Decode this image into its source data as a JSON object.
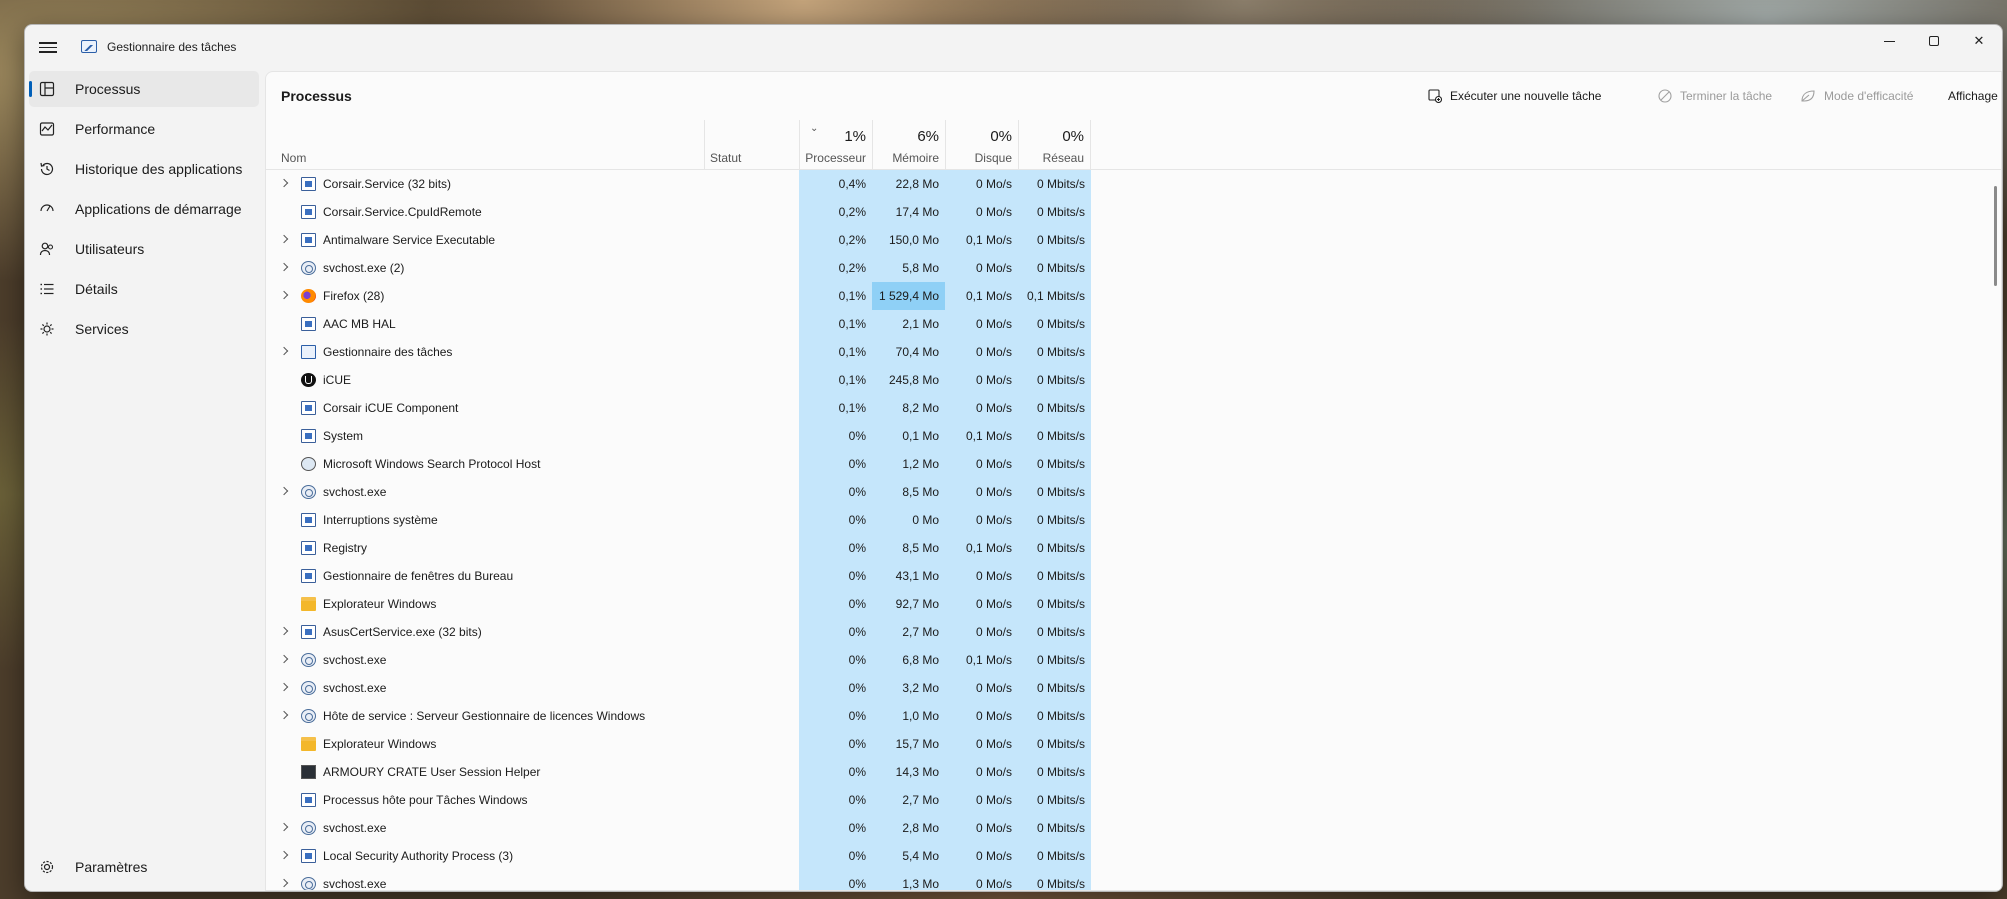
{
  "app": {
    "title": "Gestionnaire des tâches"
  },
  "sidebar": {
    "items": [
      {
        "label": "Processus",
        "icon": "processes-icon",
        "active": true
      },
      {
        "label": "Performance",
        "icon": "performance-icon"
      },
      {
        "label": "Historique des applications",
        "icon": "history-icon"
      },
      {
        "label": "Applications de démarrage",
        "icon": "startup-icon"
      },
      {
        "label": "Utilisateurs",
        "icon": "users-icon"
      },
      {
        "label": "Détails",
        "icon": "details-icon"
      },
      {
        "label": "Services",
        "icon": "services-icon"
      }
    ],
    "settings_label": "Paramètres"
  },
  "toolbar": {
    "page_title": "Processus",
    "run_task": "Exécuter une nouvelle tâche",
    "end_task": "Terminer la tâche",
    "efficiency": "Mode d'efficacité",
    "view": "Affichage"
  },
  "columns": {
    "name": "Nom",
    "status": "Statut",
    "cpu": {
      "pct": "1%",
      "label": "Processeur"
    },
    "mem": {
      "pct": "6%",
      "label": "Mémoire"
    },
    "disk": {
      "pct": "0%",
      "label": "Disque"
    },
    "net": {
      "pct": "0%",
      "label": "Réseau"
    }
  },
  "colors": {
    "accent": "#005fb8",
    "cell_bg": "#c5e6fb",
    "cell_highlight": "#8fd0f6"
  },
  "processes": [
    {
      "name": "Corsair.Service (32 bits)",
      "icon": "win",
      "expandable": true,
      "cpu": "0,4%",
      "mem": "22,8 Mo",
      "disk": "0 Mo/s",
      "net": "0 Mbits/s"
    },
    {
      "name": "Corsair.Service.CpuIdRemote",
      "icon": "win",
      "expandable": false,
      "cpu": "0,2%",
      "mem": "17,4 Mo",
      "disk": "0 Mo/s",
      "net": "0 Mbits/s"
    },
    {
      "name": "Antimalware Service Executable",
      "icon": "win",
      "expandable": true,
      "cpu": "0,2%",
      "mem": "150,0 Mo",
      "disk": "0,1 Mo/s",
      "net": "0 Mbits/s"
    },
    {
      "name": "svchost.exe (2)",
      "icon": "gear",
      "expandable": true,
      "cpu": "0,2%",
      "mem": "5,8 Mo",
      "disk": "0 Mo/s",
      "net": "0 Mbits/s"
    },
    {
      "name": "Firefox (28)",
      "icon": "ff",
      "expandable": true,
      "cpu": "0,1%",
      "mem": "1 529,4 Mo",
      "mem_hi": true,
      "disk": "0,1 Mo/s",
      "net": "0,1 Mbits/s"
    },
    {
      "name": "AAC MB HAL",
      "icon": "win",
      "expandable": false,
      "cpu": "0,1%",
      "mem": "2,1 Mo",
      "disk": "0 Mo/s",
      "net": "0 Mbits/s"
    },
    {
      "name": "Gestionnaire des tâches",
      "icon": "tm",
      "expandable": true,
      "cpu": "0,1%",
      "mem": "70,4 Mo",
      "disk": "0 Mo/s",
      "net": "0 Mbits/s"
    },
    {
      "name": "iCUE",
      "icon": "icue",
      "expandable": false,
      "cpu": "0,1%",
      "mem": "245,8 Mo",
      "disk": "0 Mo/s",
      "net": "0 Mbits/s"
    },
    {
      "name": "Corsair iCUE Component",
      "icon": "win",
      "expandable": false,
      "cpu": "0,1%",
      "mem": "8,2 Mo",
      "disk": "0 Mo/s",
      "net": "0 Mbits/s"
    },
    {
      "name": "System",
      "icon": "win",
      "expandable": false,
      "cpu": "0%",
      "mem": "0,1 Mo",
      "disk": "0,1 Mo/s",
      "net": "0 Mbits/s"
    },
    {
      "name": "Microsoft Windows Search Protocol Host",
      "icon": "search",
      "expandable": false,
      "cpu": "0%",
      "mem": "1,2 Mo",
      "disk": "0 Mo/s",
      "net": "0 Mbits/s"
    },
    {
      "name": "svchost.exe",
      "icon": "gear",
      "expandable": true,
      "cpu": "0%",
      "mem": "8,5 Mo",
      "disk": "0 Mo/s",
      "net": "0 Mbits/s"
    },
    {
      "name": "Interruptions système",
      "icon": "win",
      "expandable": false,
      "cpu": "0%",
      "mem": "0 Mo",
      "disk": "0 Mo/s",
      "net": "0 Mbits/s"
    },
    {
      "name": "Registry",
      "icon": "win",
      "expandable": false,
      "cpu": "0%",
      "mem": "8,5 Mo",
      "disk": "0,1 Mo/s",
      "net": "0 Mbits/s"
    },
    {
      "name": "Gestionnaire de fenêtres du Bureau",
      "icon": "win",
      "expandable": false,
      "cpu": "0%",
      "mem": "43,1 Mo",
      "disk": "0 Mo/s",
      "net": "0 Mbits/s"
    },
    {
      "name": "Explorateur Windows",
      "icon": "folder",
      "expandable": false,
      "cpu": "0%",
      "mem": "92,7 Mo",
      "disk": "0 Mo/s",
      "net": "0 Mbits/s"
    },
    {
      "name": "AsusCertService.exe (32 bits)",
      "icon": "win",
      "expandable": true,
      "cpu": "0%",
      "mem": "2,7 Mo",
      "disk": "0 Mo/s",
      "net": "0 Mbits/s"
    },
    {
      "name": "svchost.exe",
      "icon": "gear",
      "expandable": true,
      "cpu": "0%",
      "mem": "6,8 Mo",
      "disk": "0,1 Mo/s",
      "net": "0 Mbits/s"
    },
    {
      "name": "svchost.exe",
      "icon": "gear",
      "expandable": true,
      "cpu": "0%",
      "mem": "3,2 Mo",
      "disk": "0 Mo/s",
      "net": "0 Mbits/s"
    },
    {
      "name": "Hôte de service : Serveur Gestionnaire de licences Windows",
      "icon": "gear",
      "expandable": true,
      "cpu": "0%",
      "mem": "1,0 Mo",
      "disk": "0 Mo/s",
      "net": "0 Mbits/s"
    },
    {
      "name": "Explorateur Windows",
      "icon": "folder",
      "expandable": false,
      "cpu": "0%",
      "mem": "15,7 Mo",
      "disk": "0 Mo/s",
      "net": "0 Mbits/s"
    },
    {
      "name": "ARMOURY CRATE User Session Helper",
      "icon": "dark",
      "expandable": false,
      "cpu": "0%",
      "mem": "14,3 Mo",
      "disk": "0 Mo/s",
      "net": "0 Mbits/s"
    },
    {
      "name": "Processus hôte pour Tâches Windows",
      "icon": "win",
      "expandable": false,
      "cpu": "0%",
      "mem": "2,7 Mo",
      "disk": "0 Mo/s",
      "net": "0 Mbits/s"
    },
    {
      "name": "svchost.exe",
      "icon": "gear",
      "expandable": true,
      "cpu": "0%",
      "mem": "2,8 Mo",
      "disk": "0 Mo/s",
      "net": "0 Mbits/s"
    },
    {
      "name": "Local Security Authority Process (3)",
      "icon": "win",
      "expandable": true,
      "cpu": "0%",
      "mem": "5,4 Mo",
      "disk": "0 Mo/s",
      "net": "0 Mbits/s"
    },
    {
      "name": "svchost.exe",
      "icon": "gear",
      "expandable": true,
      "cpu": "0%",
      "mem": "1,3 Mo",
      "disk": "0 Mo/s",
      "net": "0 Mbits/s"
    }
  ]
}
